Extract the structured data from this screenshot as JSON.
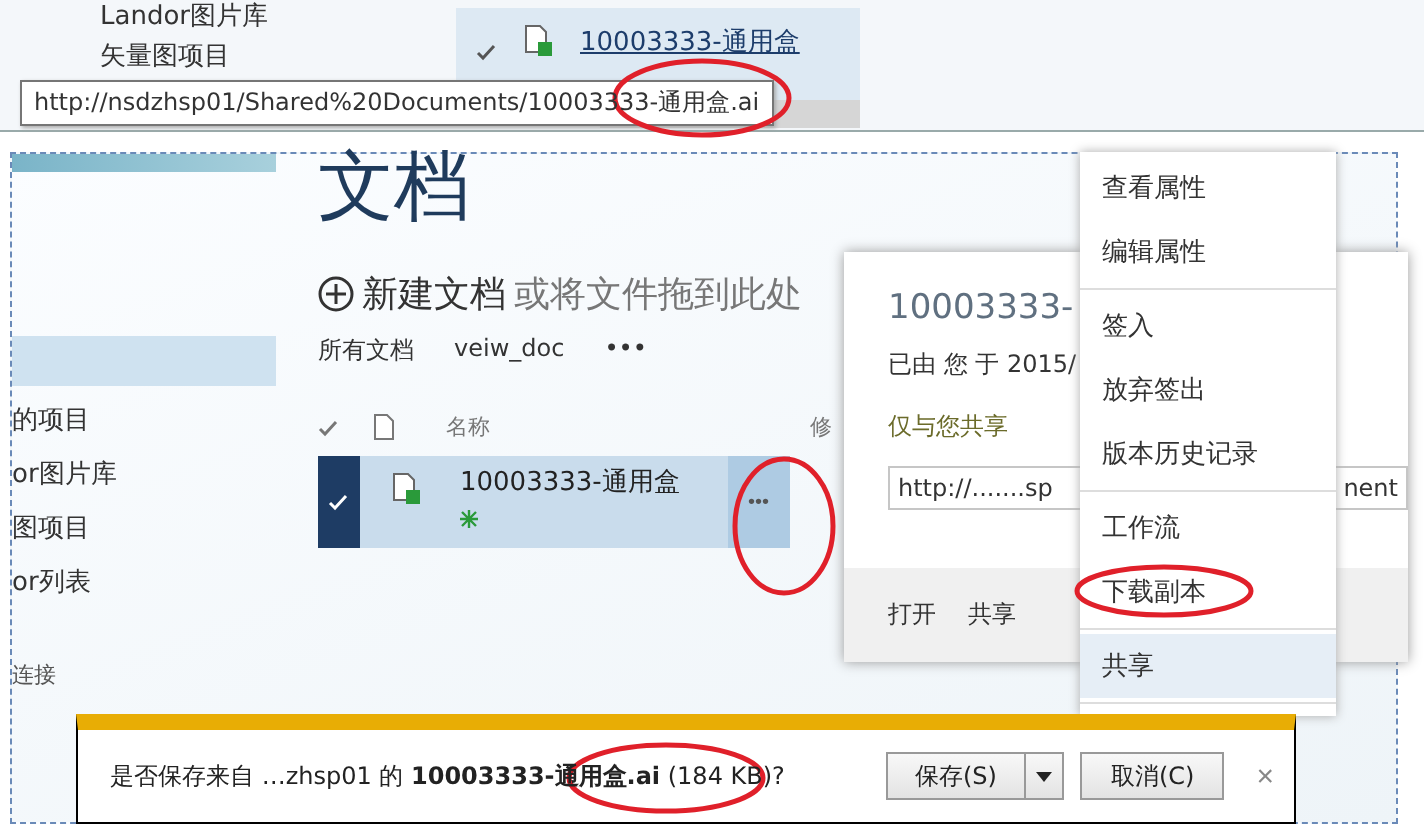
{
  "top_strip": {
    "nav_items": [
      "Landor图片库",
      "矢量图项目"
    ],
    "row": {
      "checked": true,
      "name": "10003333-通用盒"
    },
    "tooltip": "http://nsdzhsp01/Shared%20Documents/10003333-通用盒.ai"
  },
  "sidebar": {
    "items": [
      "的项目",
      "or图片库",
      "图项目",
      "or列表",
      "连接"
    ]
  },
  "page_title": "文档",
  "new_document": {
    "action": "新建文档",
    "hint": "或将文件拖到此处"
  },
  "views": [
    "所有文档",
    "veiw_doc",
    "•••"
  ],
  "table": {
    "columns": [
      "名称",
      "修"
    ],
    "rows": [
      {
        "name": "10003333-通用盒",
        "selected": true,
        "menu": "•••"
      }
    ]
  },
  "callout": {
    "title": "10003333-",
    "meta": "已由 您 于 2015/",
    "sharing": "仅与您共享",
    "url_start": "http://.......sp",
    "url_end": "nent",
    "actions": [
      "打开",
      "共享"
    ]
  },
  "context_menu": {
    "groups": [
      [
        {
          "label": "查看属性",
          "selected": false
        },
        {
          "label": "编辑属性",
          "selected": false
        }
      ],
      [
        {
          "label": "签入",
          "selected": false
        },
        {
          "label": "放弃签出",
          "selected": false
        },
        {
          "label": "版本历史记录",
          "selected": false
        }
      ],
      [
        {
          "label": "工作流",
          "selected": false
        },
        {
          "label": "下载副本",
          "selected": false
        }
      ],
      [
        {
          "label": "共享",
          "selected": true
        }
      ]
    ]
  },
  "download_bar": {
    "message": "是否保存来自 …zhsp01 的 **10003333-通用盒.ai** (184 KB)?",
    "buttons": [
      {
        "label": "保存(S)",
        "kind": "split"
      },
      {
        "label": "取消(C)",
        "kind": "plain"
      }
    ],
    "close": "×"
  }
}
